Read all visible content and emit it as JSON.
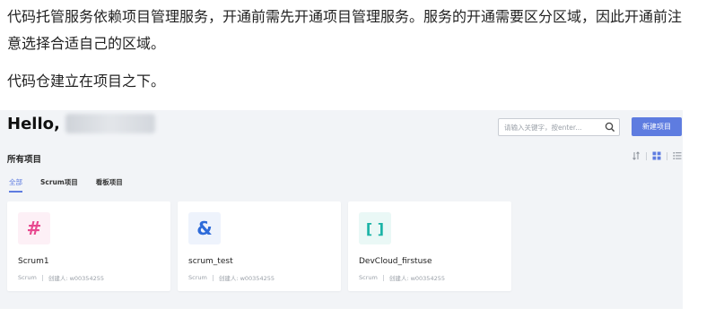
{
  "document": {
    "paragraph1": "代码托管服务依赖项目管理服务，开通前需先开通项目管理服务。服务的开通需要区分区域，因此开通前注意选择合适自己的区域。",
    "paragraph2": "代码仓建立在项目之下。"
  },
  "screen": {
    "greeting": "Hello,",
    "search": {
      "placeholder": "请输入关键字，按enter..."
    },
    "new_project_label": "新建项目",
    "section_title": "所有项目",
    "tabs": [
      {
        "label": "全部",
        "active": true
      },
      {
        "label": "Scrum项目",
        "active": false
      },
      {
        "label": "看板项目",
        "active": false
      }
    ],
    "projects": [
      {
        "name": "Scrum1",
        "type": "Scrum",
        "creator": "创建人: w00354255",
        "icon": "#",
        "icon_color": "#e8488f",
        "icon_bg": "#fdf0f6"
      },
      {
        "name": "scrum_test",
        "type": "Scrum",
        "creator": "创建人: w00354255",
        "icon": "&",
        "icon_color": "#2e6bd9",
        "icon_bg": "#eef3fc"
      },
      {
        "name": "DevCloud_firstuse",
        "type": "Scrum",
        "creator": "创建人: w00354255",
        "icon": "[ ]",
        "icon_color": "#1bb3a6",
        "icon_bg": "#eaf8f6"
      }
    ]
  },
  "colors": {
    "accent": "#5e7ce0",
    "background": "#f2f4f7"
  }
}
